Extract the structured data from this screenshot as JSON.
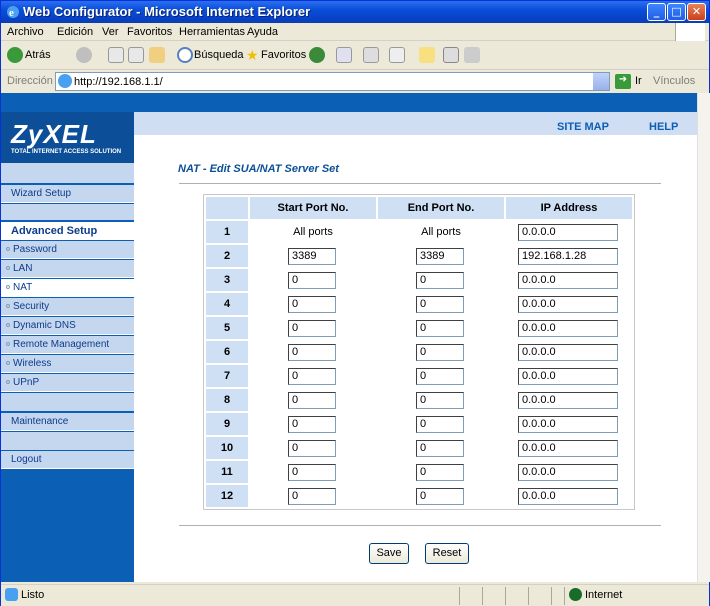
{
  "window": {
    "title": "Web Configurator - Microsoft Internet Explorer"
  },
  "menu": [
    "Archivo",
    "Edición",
    "Ver",
    "Favoritos",
    "Herramientas",
    "Ayuda"
  ],
  "toolbar": {
    "back": "Atrás",
    "search": "Búsqueda",
    "favorites": "Favoritos"
  },
  "address": {
    "label": "Dirección",
    "url": "http://192.168.1.1/",
    "go": "Ir",
    "links": "Vínculos"
  },
  "brand": {
    "logo": "ZyXEL",
    "tagline": "TOTAL INTERNET ACCESS SOLUTION"
  },
  "header_links": {
    "site_map": "SITE MAP",
    "help": "HELP"
  },
  "nav": {
    "wizard": "Wizard Setup",
    "advanced": "Advanced Setup",
    "password": "Password",
    "lan": "LAN",
    "nat": "NAT",
    "security": "Security",
    "dns": "Dynamic DNS",
    "remote": "Remote Management",
    "wireless": "Wireless",
    "upnp": "UPnP",
    "maintenance": "Maintenance",
    "logout": "Logout"
  },
  "page_title": "NAT - Edit SUA/NAT Server Set",
  "table": {
    "headers": [
      "",
      "Start Port No.",
      "End Port No.",
      "IP Address"
    ],
    "rows": [
      {
        "no": "1",
        "start": "All ports",
        "end": "All ports",
        "ip": "0.0.0.0",
        "static": true
      },
      {
        "no": "2",
        "start": "3389",
        "end": "3389",
        "ip": "192.168.1.28"
      },
      {
        "no": "3",
        "start": "0",
        "end": "0",
        "ip": "0.0.0.0"
      },
      {
        "no": "4",
        "start": "0",
        "end": "0",
        "ip": "0.0.0.0"
      },
      {
        "no": "5",
        "start": "0",
        "end": "0",
        "ip": "0.0.0.0"
      },
      {
        "no": "6",
        "start": "0",
        "end": "0",
        "ip": "0.0.0.0"
      },
      {
        "no": "7",
        "start": "0",
        "end": "0",
        "ip": "0.0.0.0"
      },
      {
        "no": "8",
        "start": "0",
        "end": "0",
        "ip": "0.0.0.0"
      },
      {
        "no": "9",
        "start": "0",
        "end": "0",
        "ip": "0.0.0.0"
      },
      {
        "no": "10",
        "start": "0",
        "end": "0",
        "ip": "0.0.0.0"
      },
      {
        "no": "11",
        "start": "0",
        "end": "0",
        "ip": "0.0.0.0"
      },
      {
        "no": "12",
        "start": "0",
        "end": "0",
        "ip": "0.0.0.0"
      }
    ]
  },
  "buttons": {
    "save": "Save",
    "reset": "Reset"
  },
  "status": {
    "text": "Listo",
    "zone": "Internet"
  },
  "colors": {
    "brand_blue": "#0b5fb5",
    "nav_bg": "#c5d6ef",
    "table_header": "#cfe0f5"
  }
}
